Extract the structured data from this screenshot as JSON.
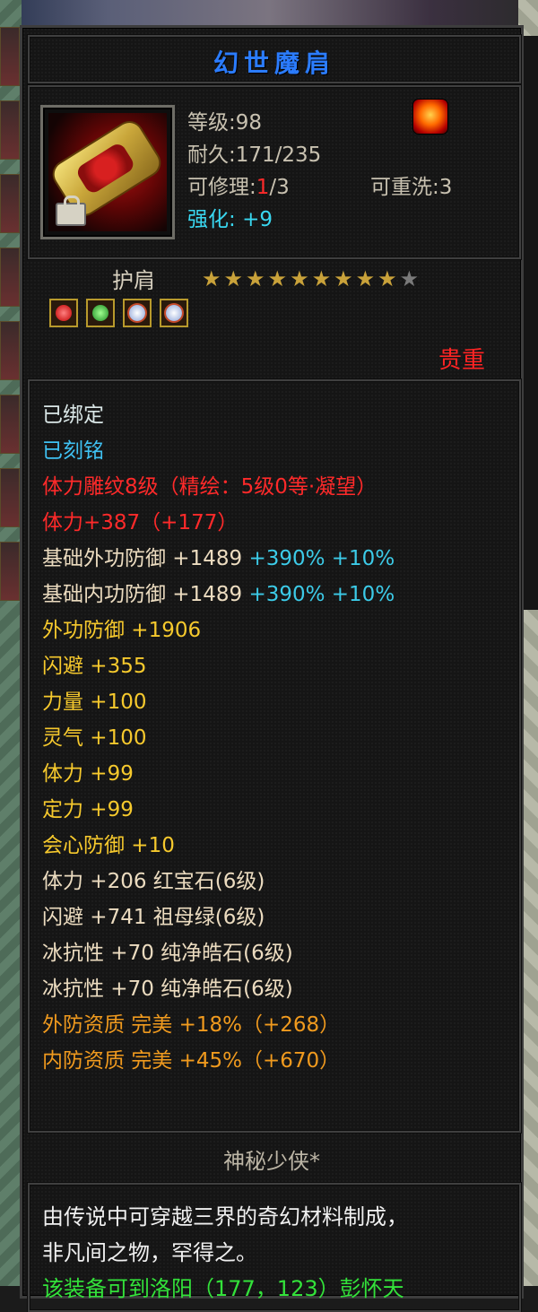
{
  "item": {
    "name": "幻世魔肩",
    "level_label": "等级",
    "level_value": ":98",
    "durability_label": "耐久",
    "durability_value": ":171/235",
    "repair_label": "可修理",
    "repair_used": "1",
    "repair_total": "/3",
    "rewash_label": "可重洗",
    "rewash_value": ":3",
    "enhance_label": "强化:",
    "enhance_value": "+9",
    "type": "护肩",
    "stars_filled": "★★★★★★★★★",
    "stars_empty": "★",
    "star_count": 9,
    "star_max": 10,
    "gems": [
      "ruby",
      "emerald",
      "diamond",
      "diamond"
    ],
    "rarity": "贵重"
  },
  "attributes": [
    {
      "text": "已绑定",
      "color": "white"
    },
    {
      "text": "已刻铭",
      "color": "cyan"
    },
    {
      "text": "体力雕纹8级（精绘：5级0等·凝望）",
      "color": "red"
    },
    {
      "text": "体力+387（+177）",
      "color": "red"
    },
    {
      "text": "基础外功防御 +1489 ",
      "pct": "+390% +10%",
      "color": "beige"
    },
    {
      "text": "基础内功防御 +1489 ",
      "pct": "+390% +10%",
      "color": "beige"
    },
    {
      "text": "外功防御 +1906",
      "color": "yellow"
    },
    {
      "text": "闪避 +355",
      "color": "yellow"
    },
    {
      "text": "力量 +100",
      "color": "yellow"
    },
    {
      "text": "灵气 +100",
      "color": "yellow"
    },
    {
      "text": "体力 +99",
      "color": "yellow"
    },
    {
      "text": "定力 +99",
      "color": "yellow"
    },
    {
      "text": "会心防御 +10",
      "color": "yellow"
    },
    {
      "text": "体力 +206 红宝石(6级)",
      "color": "beige"
    },
    {
      "text": "闪避 +741 祖母绿(6级)",
      "color": "beige"
    },
    {
      "text": "冰抗性 +70 纯净皓石(6级)",
      "color": "beige"
    },
    {
      "text": "冰抗性 +70 纯净皓石(6级)",
      "color": "beige"
    },
    {
      "text": "外防资质  完美 +18%（+268）",
      "color": "orange"
    },
    {
      "text": "内防资质  完美 +45%（+670）",
      "color": "orange"
    }
  ],
  "author": "神秘少侠*",
  "description": {
    "line1": "由传说中可穿越三界的奇幻材料制成，",
    "line2": "非凡间之物，罕得之。",
    "line3": "该装备可到洛阳（177，123）彭怀天"
  },
  "colors": {
    "title": "#2b7cff",
    "rarity": "#ff2424",
    "enhance": "#39d7f0"
  }
}
